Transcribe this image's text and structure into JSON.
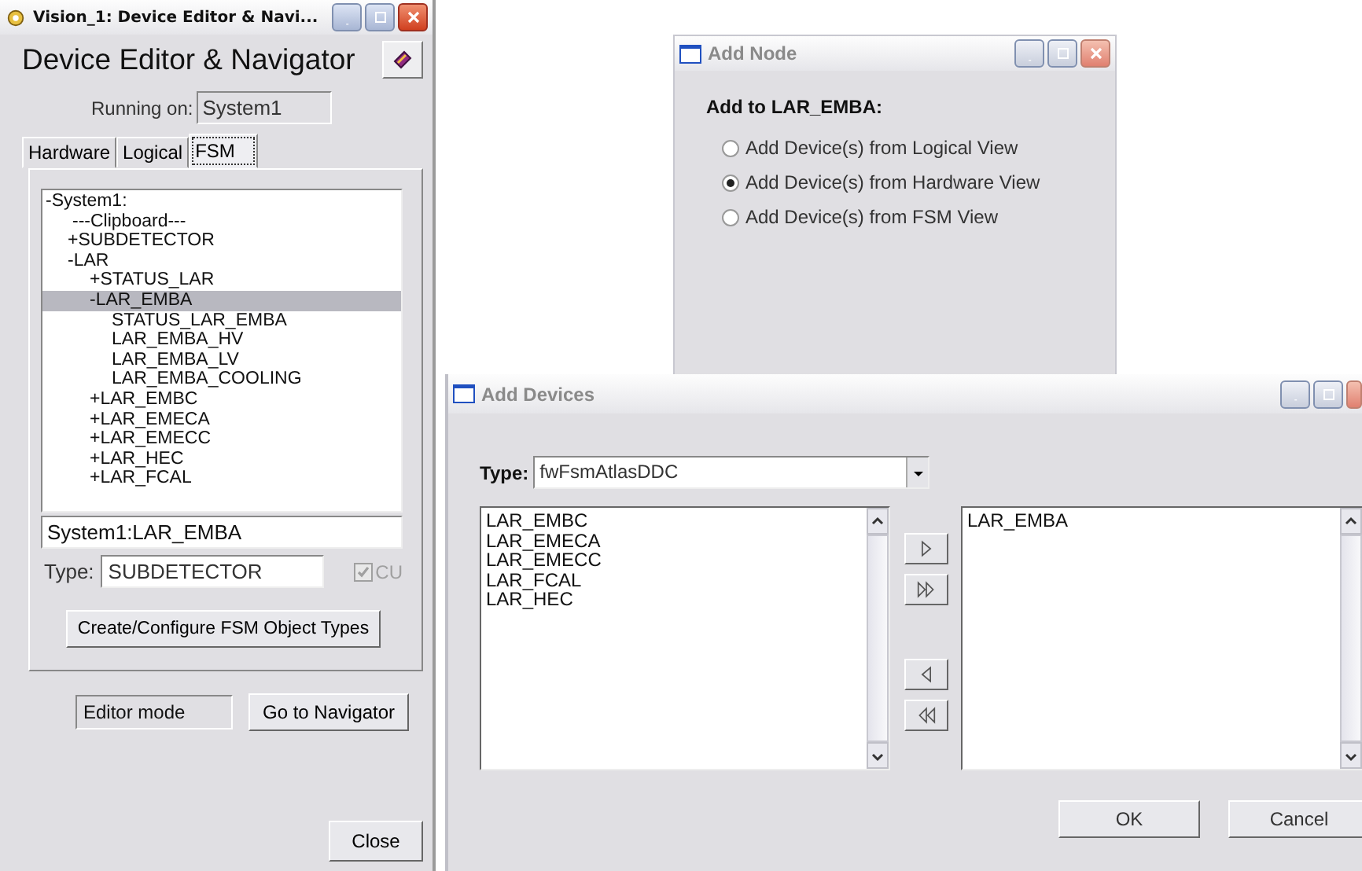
{
  "left_window": {
    "title": "Vision_1: Device Editor & Navi...",
    "heading": "Device Editor & Navigator",
    "running_on_label": "Running on:",
    "running_on_value": "System1",
    "tabs": [
      {
        "label": "Hardware",
        "selected": false
      },
      {
        "label": "Logical",
        "selected": false
      },
      {
        "label": "FSM",
        "selected": true
      }
    ],
    "tree": [
      {
        "label": "-System1:",
        "selected": false,
        "children": [
          {
            "label": "---Clipboard---",
            "selected": false
          },
          {
            "label": "+SUBDETECTOR",
            "selected": false
          },
          {
            "label": "-LAR",
            "selected": false,
            "children": [
              {
                "label": "+STATUS_LAR",
                "selected": false
              },
              {
                "label": "-LAR_EMBA",
                "selected": true,
                "children": [
                  {
                    "label": "STATUS_LAR_EMBA",
                    "selected": false
                  },
                  {
                    "label": "LAR_EMBA_HV",
                    "selected": false
                  },
                  {
                    "label": "LAR_EMBA_LV",
                    "selected": false
                  },
                  {
                    "label": "LAR_EMBA_COOLING",
                    "selected": false
                  }
                ]
              },
              {
                "label": "+LAR_EMBC",
                "selected": false
              },
              {
                "label": "+LAR_EMECA",
                "selected": false
              },
              {
                "label": "+LAR_EMECC",
                "selected": false
              },
              {
                "label": "+LAR_HEC",
                "selected": false
              },
              {
                "label": "+LAR_FCAL",
                "selected": false
              }
            ]
          }
        ]
      }
    ],
    "selected_path": "System1:LAR_EMBA",
    "type_label": "Type:",
    "type_value": "SUBDETECTOR",
    "cu": {
      "label": "CU",
      "checked": true,
      "disabled": true
    },
    "configure_button": "Create/Configure FSM Object Types",
    "mode": "Editor mode",
    "navigator_button": "Go to Navigator",
    "close_button": "Close"
  },
  "add_node": {
    "title": "Add Node",
    "heading": "Add to LAR_EMBA:",
    "options": [
      {
        "label": "Add Device(s) from Logical View",
        "selected": false
      },
      {
        "label": "Add Device(s) from Hardware View",
        "selected": true
      },
      {
        "label": "Add Device(s) from FSM View",
        "selected": false
      }
    ]
  },
  "add_devices": {
    "title": "Add Devices",
    "type_label": "Type:",
    "type_value": "fwFsmAtlasDDC",
    "available": [
      "LAR_EMBC",
      "LAR_EMECA",
      "LAR_EMECC",
      "LAR_FCAL",
      "LAR_HEC"
    ],
    "chosen": [
      "LAR_EMBA"
    ],
    "buttons": [
      "OK",
      "Cancel"
    ]
  }
}
